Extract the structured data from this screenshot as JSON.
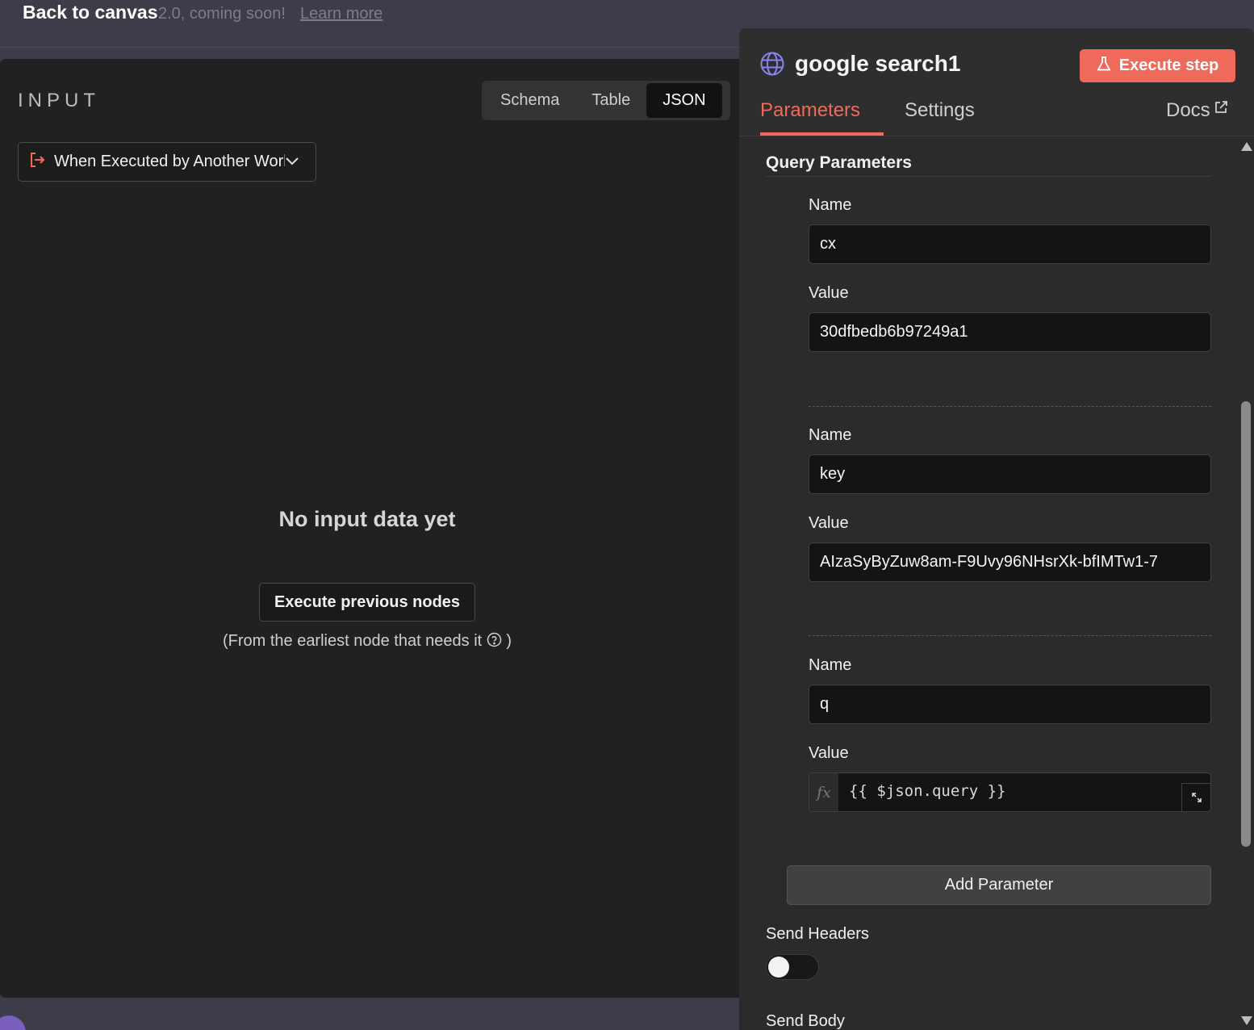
{
  "banner": {
    "text": "2.0, coming soon!",
    "link": "Learn more",
    "back_label": "Back to canvas"
  },
  "input_panel": {
    "title": "INPUT",
    "view_tabs": [
      "Schema",
      "Table",
      "JSON"
    ],
    "active_view": "JSON",
    "trigger_select": "When Executed by Another Workflow",
    "empty_title": "No input data yet",
    "execute_previous_label": "Execute previous nodes",
    "hint_before": "(From the earliest node that needs it",
    "hint_after": ")"
  },
  "node_panel": {
    "title": "google search1",
    "icon": "globe-icon",
    "execute_step_label": "Execute step",
    "tabs": {
      "parameters": "Parameters",
      "settings": "Settings",
      "docs": "Docs"
    },
    "active_tab": "Parameters",
    "section_title": "Query Parameters",
    "name_label": "Name",
    "value_label": "Value",
    "params": [
      {
        "name": "cx",
        "value": "30dfbedb6b97249a1"
      },
      {
        "name": "key",
        "value": "AIzaSyByZuw8am-F9Uvy96NHsrXk-bfIMTw1-7"
      },
      {
        "name": "q",
        "value": "{{ $json.query }}",
        "expression": true
      }
    ],
    "add_parameter_label": "Add Parameter",
    "send_headers_label": "Send Headers",
    "send_headers_enabled": false,
    "send_body_label": "Send Body",
    "colors": {
      "accent": "#ef6a5a",
      "icon": "#8b82f0"
    }
  }
}
